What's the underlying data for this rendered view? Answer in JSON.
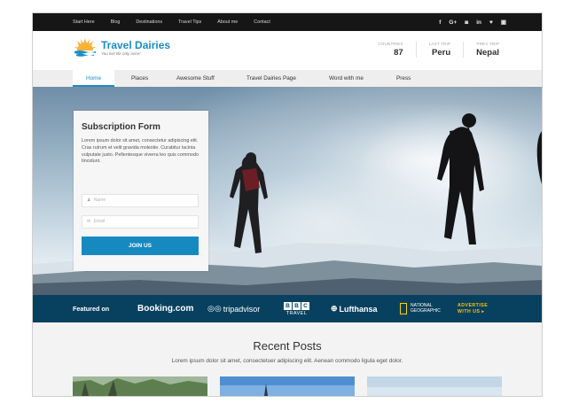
{
  "topnav": [
    "Start Here",
    "Blog",
    "Destinations",
    "Travel Tips",
    "About me",
    "Contact"
  ],
  "social_icons": [
    {
      "name": "facebook-icon",
      "glyph": "f"
    },
    {
      "name": "google-plus-icon",
      "glyph": "G+"
    },
    {
      "name": "instagram-icon",
      "glyph": "◙"
    },
    {
      "name": "linkedin-icon",
      "glyph": "in"
    },
    {
      "name": "twitter-icon",
      "glyph": "♥"
    },
    {
      "name": "youtube-icon",
      "glyph": "▣"
    }
  ],
  "brand": {
    "title": "Travel Dairies",
    "tagline": "You live life only once!",
    "logo_icon": "sun-over-water-icon",
    "accent": "#1a8cc4"
  },
  "stats": [
    {
      "label": "COUNTRIES",
      "value": "87"
    },
    {
      "label": "LAST TRIP",
      "value": "Peru"
    },
    {
      "label": "PREV TRIP",
      "value": "Nepal"
    }
  ],
  "mainnav": [
    {
      "label": "Home",
      "active": true
    },
    {
      "label": "Places",
      "active": false
    },
    {
      "label": "Awesome Stuff",
      "active": false
    },
    {
      "label": "Travel Dairies Page",
      "active": false
    },
    {
      "label": "Word with me",
      "active": false
    },
    {
      "label": "Press",
      "active": false
    }
  ],
  "subscribe": {
    "title": "Subscription Form",
    "text": "Lorem ipsum dolor sit amet, consectetur adipiscing elit. Cras rutrum et velit gravida molestie. Curabitur lacinia vulputate justo. Pellentesque viverra leo quis commodo tincidunt.",
    "name_placeholder": "Name",
    "email_placeholder": "Email",
    "name_icon": "user-icon",
    "email_icon": "envelope-icon",
    "button": "JOIN US"
  },
  "featured": {
    "label": "Featured on",
    "booking": "Booking.com",
    "tripadvisor": "tripadvisor",
    "bbc": [
      "B",
      "B",
      "C"
    ],
    "bbc_sub": "TRAVEL",
    "lufthansa": "Lufthansa",
    "natgeo": [
      "NATIONAL",
      "GEOGRAPHIC"
    ],
    "advertise": [
      "ADVERTISE",
      "WITH US ▸"
    ],
    "bg": "#07415f",
    "advertise_color": "#ffc400"
  },
  "recent": {
    "title": "Recent Posts",
    "subtitle": "Lorem ipsum dolor sit amet, consectetuer adipiscing elit. Aenean commodo ligula eget dolor."
  }
}
